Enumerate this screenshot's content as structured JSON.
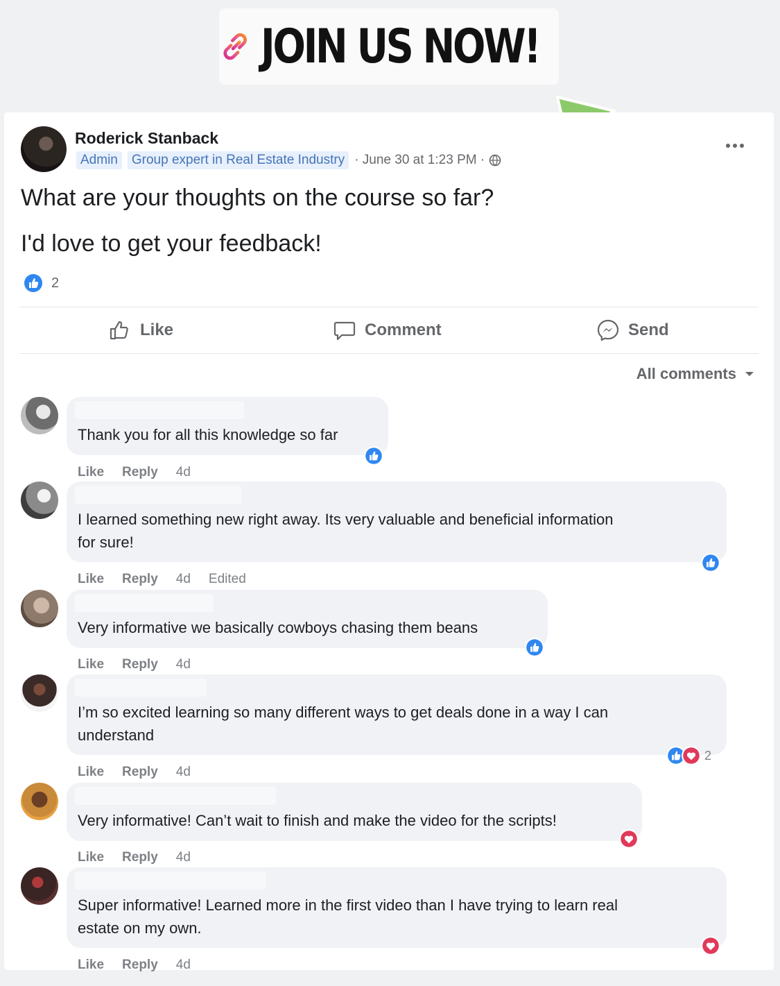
{
  "banner": {
    "text": "JOIN US NOW!"
  },
  "post": {
    "author": "Roderick Stanback",
    "badges": [
      "Admin",
      "Group expert in Real Estate Industry"
    ],
    "meta": "· June 30 at 1:23 PM ·",
    "line1": "What are your thoughts on the course so far?",
    "line2": "I'd love to get your feedback!",
    "reaction_count": "2",
    "actions": {
      "like": "Like",
      "comment": "Comment",
      "send": "Send"
    },
    "sort_label": "All comments"
  },
  "comments": [
    {
      "text_lines": [
        "Thank you for all this knowledge so far"
      ],
      "like": "Like",
      "reply": "Reply",
      "time": "4d",
      "edited": "",
      "reactions": [
        "like"
      ],
      "reaction_count": ""
    },
    {
      "text_lines": [
        "I learned something new right away. Its very valuable and beneficial information",
        "for sure!"
      ],
      "like": "Like",
      "reply": "Reply",
      "time": "4d",
      "edited": "Edited",
      "reactions": [
        "like"
      ],
      "reaction_count": ""
    },
    {
      "text_lines": [
        "Very informative we basically cowboys chasing them beans"
      ],
      "like": "Like",
      "reply": "Reply",
      "time": "4d",
      "edited": "",
      "reactions": [
        "like"
      ],
      "reaction_count": ""
    },
    {
      "text_lines": [
        "I’m so excited learning so many different ways to get deals done in a way I can",
        "understand"
      ],
      "like": "Like",
      "reply": "Reply",
      "time": "4d",
      "edited": "",
      "reactions": [
        "like",
        "love"
      ],
      "reaction_count": "2"
    },
    {
      "text_lines": [
        "Very informative! Can’t wait to finish and make the video for the scripts!"
      ],
      "like": "Like",
      "reply": "Reply",
      "time": "4d",
      "edited": "",
      "reactions": [
        "love"
      ],
      "reaction_count": ""
    },
    {
      "text_lines": [
        "Super informative! Learned more in the first video than I have trying to learn real",
        "estate on my own."
      ],
      "like": "Like",
      "reply": "Reply",
      "time": "4d",
      "edited": "",
      "reactions": [
        "love"
      ],
      "reaction_count": ""
    }
  ],
  "colors": {
    "like_blue": "#1877f2",
    "love_red": "#e0395a",
    "arrow_green": "#8cc96a",
    "link_gradient": [
      "#f7931e",
      "#d42f8e"
    ]
  }
}
